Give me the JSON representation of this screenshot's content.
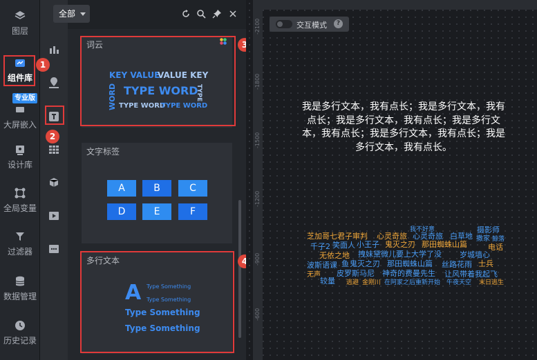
{
  "leftnav": {
    "items": [
      {
        "label": "图层",
        "icon": "layers-icon"
      },
      {
        "label": "组件库",
        "icon": "component-library-icon"
      },
      {
        "label": "大屏嵌入",
        "icon": "screen-embed-icon"
      },
      {
        "label": "设计库",
        "icon": "design-library-icon"
      },
      {
        "label": "全局变量",
        "icon": "global-variable-icon"
      },
      {
        "label": "过滤器",
        "icon": "filter-icon"
      },
      {
        "label": "数据管理",
        "icon": "database-icon"
      },
      {
        "label": "历史记录",
        "icon": "history-icon"
      }
    ],
    "pro_badge": "专业版"
  },
  "panel": {
    "filter": "全部",
    "wordcloud": {
      "title": "词云",
      "words": [
        "KEY VALUE",
        "VALUE KEY",
        "WORD",
        "TYPE WORD",
        "TYPE",
        "TYPE WORD",
        "TYPE WORD"
      ]
    },
    "texttag": {
      "title": "文字标签",
      "tags": [
        "A",
        "B",
        "C",
        "D",
        "E",
        "F"
      ]
    },
    "multiline": {
      "title": "多行文本",
      "letter": "A",
      "small1": "Type Something",
      "small2": "Type Something",
      "big1": "Type Something",
      "big2": "Type Something"
    }
  },
  "annotations": [
    "1",
    "2",
    "3",
    "4"
  ],
  "canvas": {
    "interactive_mode": "交互模式",
    "help": "?",
    "ruler": [
      "-2100",
      "-1800",
      "-1500",
      "-1200",
      "-900",
      "-600"
    ],
    "multiline_text": "我是多行文本，我有点长；我是多行文本，我有点长；我是多行文本，我有点长；我是多行文本，我有点长；我是多行文本，我有点长；我是多行文本，我有点长。",
    "cloud_words": [
      "我不好意",
      "摄影师",
      "芝加哥七君子审判",
      "心灵奇旅",
      "心灵奇旅",
      "白草地",
      "撒家",
      "鲸落",
      "千子2",
      "笑面人",
      "小王子",
      "鬼灭之刃",
      "那田蜘蛛山篇",
      "电话",
      "无依之地",
      "拽妹黛微儿要上大学了没",
      "岁城墙心",
      "波斯语课",
      "鱼",
      "鬼灭之刃",
      "那田蜘蛛山篇",
      "丝路花雨",
      "士兵",
      "无声",
      "皮罗斯马尼",
      "神奇的费曼先生",
      "让风带着我起飞",
      "较量",
      "逃避",
      "金刚川",
      "在阿家之后重新开始",
      "午夜天空",
      "末日逃生"
    ]
  },
  "colors": {
    "accent": "#3d8bf0",
    "annotation_red": "#e13a3a",
    "cloud_orange": "#f0a73a",
    "cloud_blue": "#4a9cf5"
  }
}
